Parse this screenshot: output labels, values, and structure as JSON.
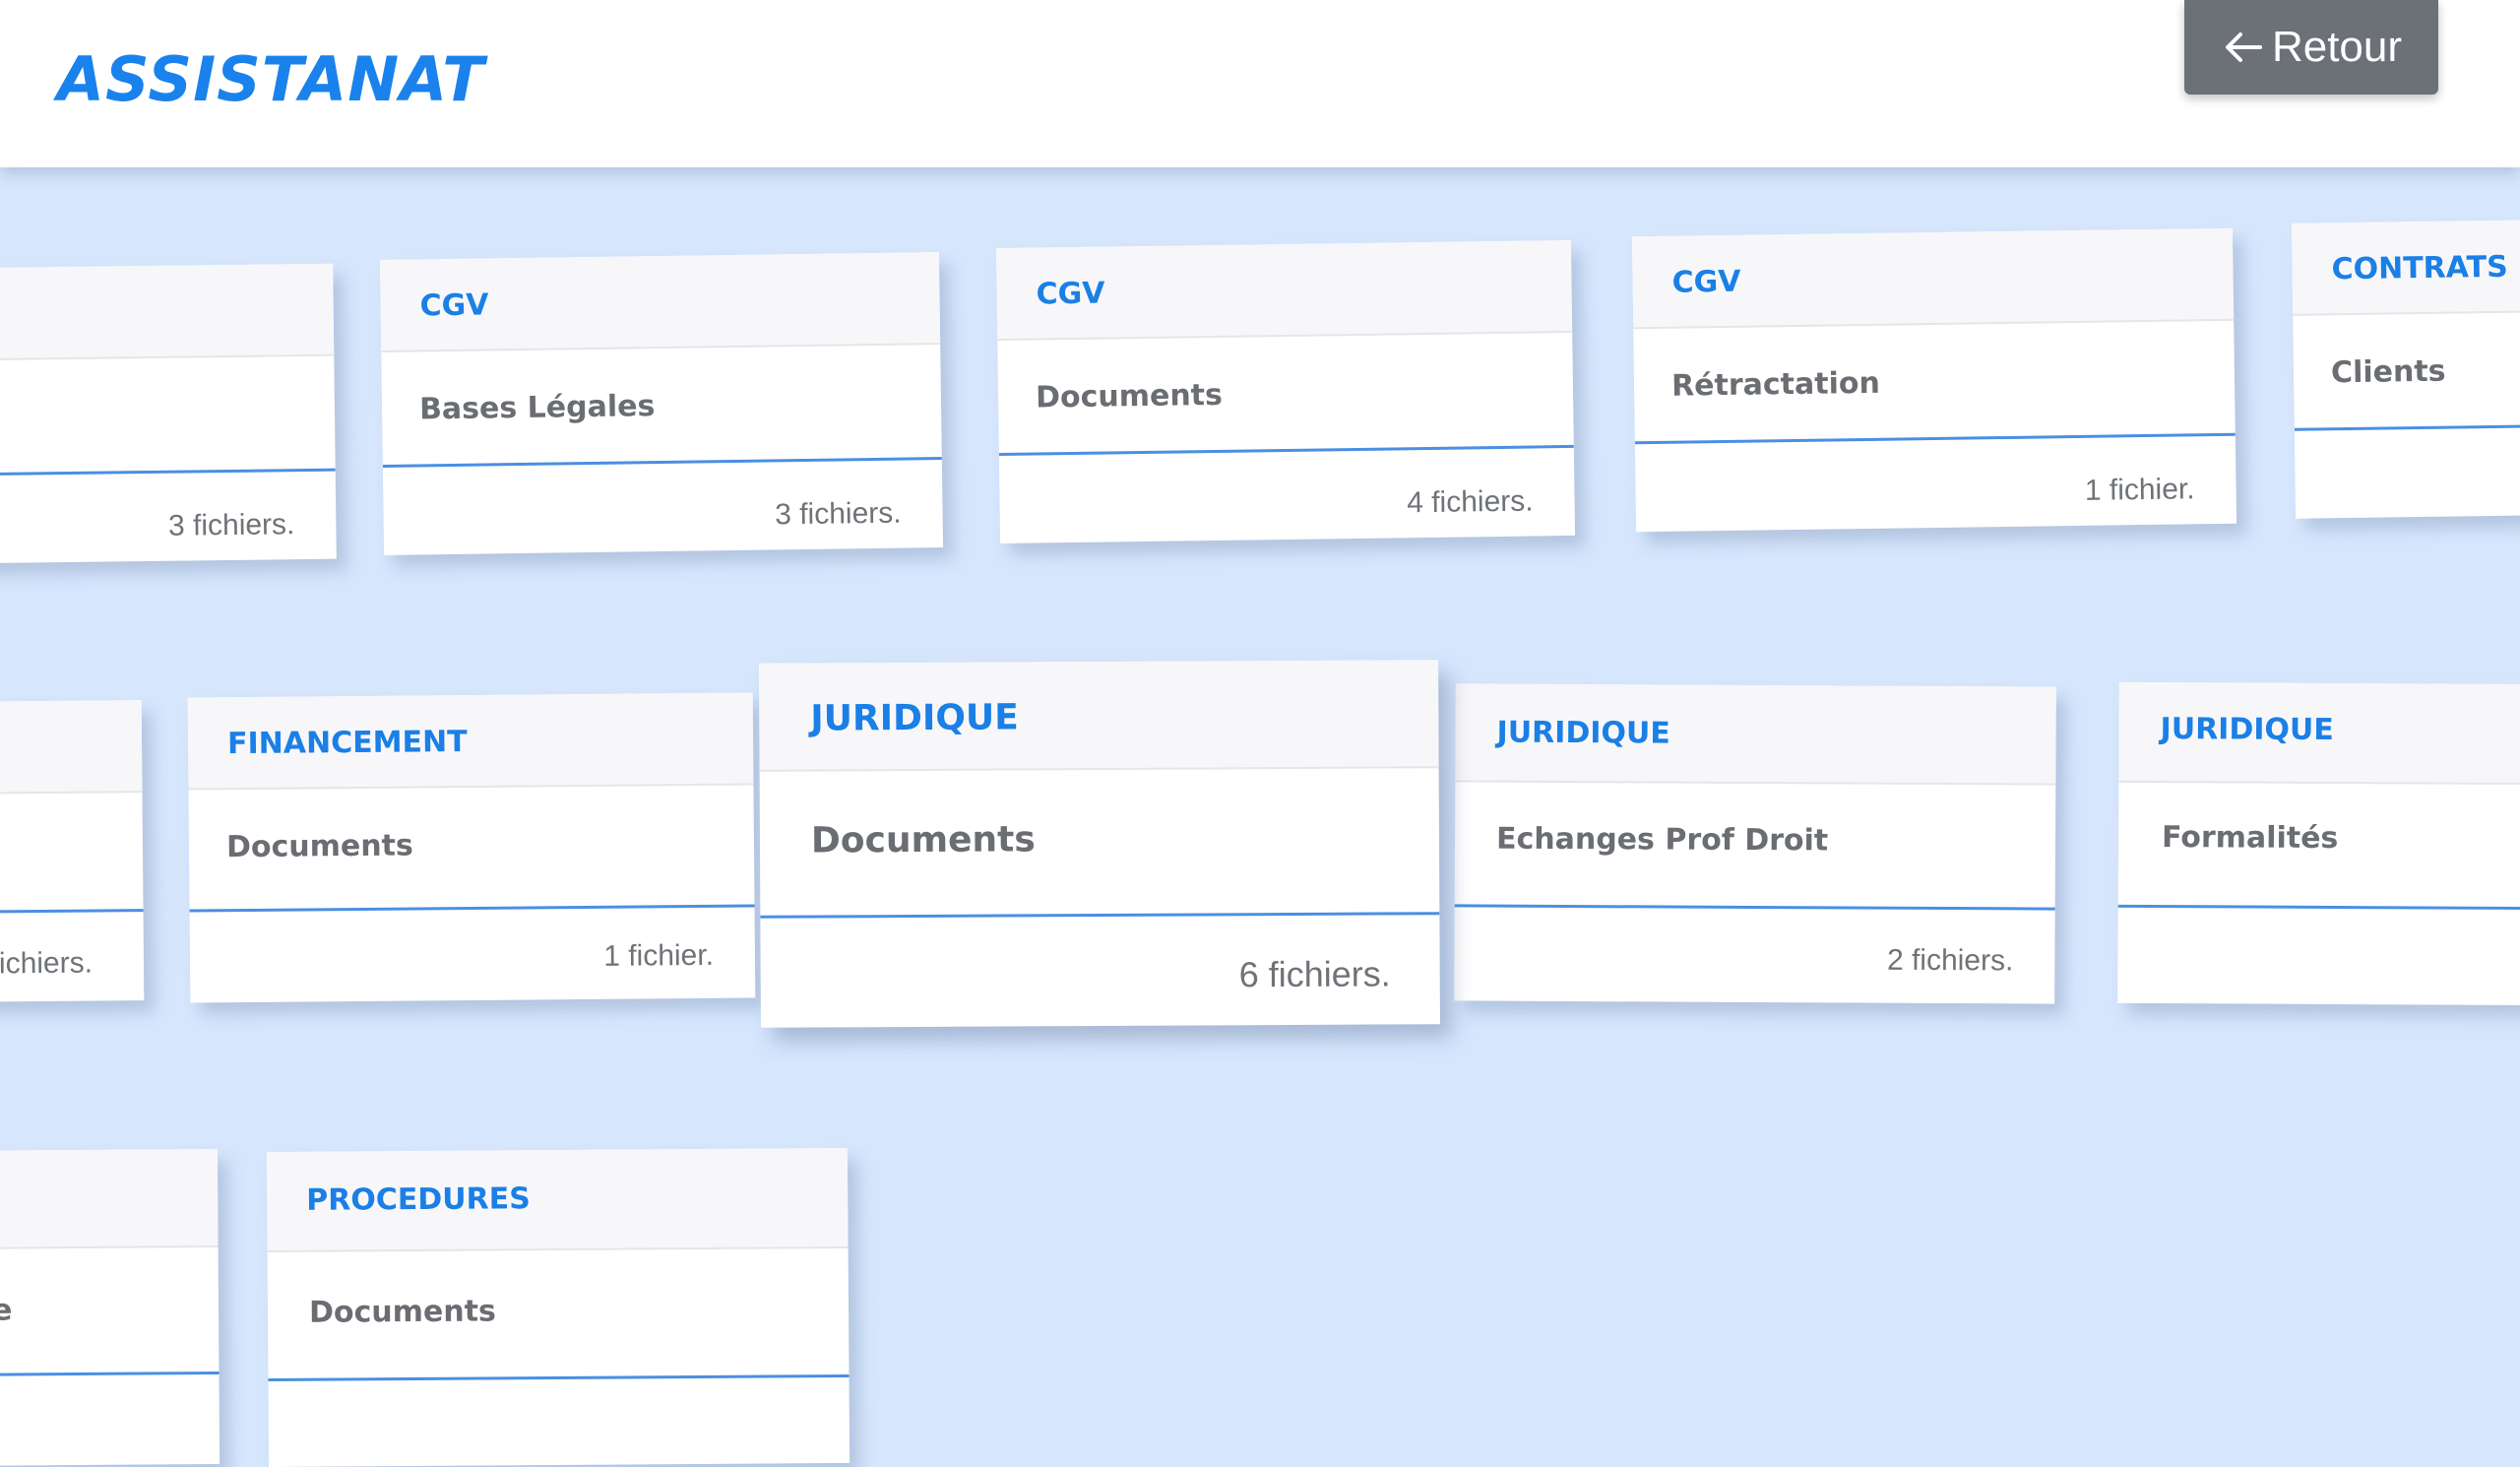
{
  "header": {
    "title": "ASSISTANAT",
    "back_label": "Retour",
    "back_icon": "arrow-left-icon"
  },
  "colors": {
    "accent": "#1a82ec",
    "background": "#d6e6fd",
    "button": "#6b7177",
    "divider": "#4a8fe2"
  },
  "cards": [
    {
      "category": "",
      "subject": "",
      "count": "3 fichiers."
    },
    {
      "category": "CGV",
      "subject": "Bases Légales",
      "count": "3 fichiers."
    },
    {
      "category": "CGV",
      "subject": "Documents",
      "count": "4 fichiers."
    },
    {
      "category": "CGV",
      "subject": "Rétractation",
      "count": "1 fichier."
    },
    {
      "category": "CONTRATS",
      "subject": "Clients",
      "count": ""
    },
    {
      "category": "",
      "subject": "",
      "count": "ichiers."
    },
    {
      "category": "FINANCEMENT",
      "subject": "Documents",
      "count": "1 fichier."
    },
    {
      "category": "JURIDIQUE",
      "subject": "Documents",
      "count": "6 fichiers."
    },
    {
      "category": "JURIDIQUE",
      "subject": "Echanges Prof Droit",
      "count": "2 fichiers."
    },
    {
      "category": "JURIDIQUE",
      "subject": "Formalités",
      "count": ""
    },
    {
      "category": "",
      "subject": "e",
      "count": ""
    },
    {
      "category": "PROCEDURES",
      "subject": "Documents",
      "count": ""
    }
  ]
}
